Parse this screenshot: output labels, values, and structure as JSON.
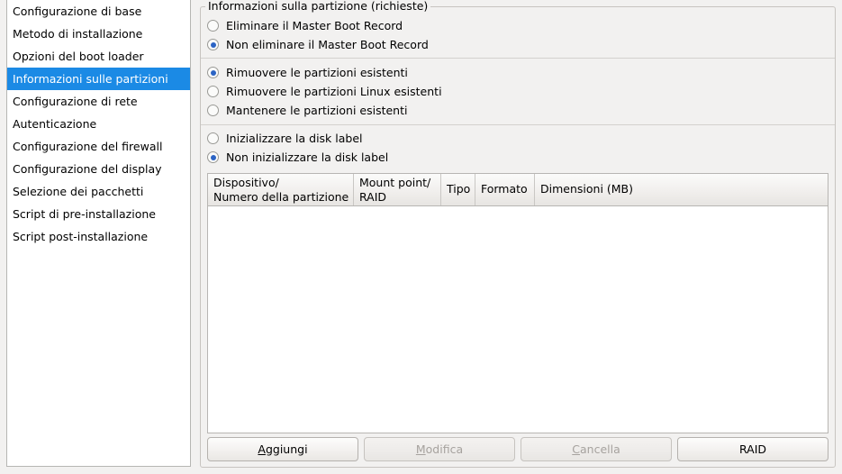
{
  "sidebar": {
    "items": [
      {
        "label": "Configurazione di base",
        "selected": false
      },
      {
        "label": "Metodo di installazione",
        "selected": false
      },
      {
        "label": "Opzioni del boot loader",
        "selected": false
      },
      {
        "label": "Informazioni sulle partizioni",
        "selected": true
      },
      {
        "label": "Configurazione di rete",
        "selected": false
      },
      {
        "label": "Autenticazione",
        "selected": false
      },
      {
        "label": "Configurazione del firewall",
        "selected": false
      },
      {
        "label": "Configurazione del display",
        "selected": false
      },
      {
        "label": "Selezione dei pacchetti",
        "selected": false
      },
      {
        "label": "Script di pre-installazione",
        "selected": false
      },
      {
        "label": "Script post-installazione",
        "selected": false
      }
    ]
  },
  "groupbox": {
    "title": "Informazioni sulla partizione (richieste)"
  },
  "radio_groups": [
    {
      "name": "mbr",
      "options": [
        {
          "label": "Eliminare il Master Boot Record",
          "checked": false
        },
        {
          "label": "Non eliminare il Master Boot Record",
          "checked": true
        }
      ]
    },
    {
      "name": "partitions",
      "options": [
        {
          "label": "Rimuovere le partizioni esistenti",
          "checked": true
        },
        {
          "label": "Rimuovere le partizioni Linux esistenti",
          "checked": false
        },
        {
          "label": "Mantenere le partizioni esistenti",
          "checked": false
        }
      ]
    },
    {
      "name": "disklabel",
      "options": [
        {
          "label": "Inizializzare la disk label",
          "checked": false
        },
        {
          "label": "Non inizializzare la disk label",
          "checked": true
        }
      ]
    }
  ],
  "table": {
    "columns": [
      "Dispositivo/\nNumero della partizione",
      "Mount point/\nRAID",
      "Tipo",
      "Formato",
      "Dimensioni (MB)"
    ],
    "rows": []
  },
  "buttons": [
    {
      "label": "Aggiungi",
      "mnemonic": "A",
      "enabled": true
    },
    {
      "label": "Modifica",
      "mnemonic": "M",
      "enabled": false
    },
    {
      "label": "Cancella",
      "mnemonic": "C",
      "enabled": false
    },
    {
      "label": "RAID",
      "mnemonic": "",
      "enabled": true
    }
  ],
  "colors": {
    "selection": "#1b8ae5",
    "radio_dot": "#2b63c4",
    "window_bg": "#f2f1f0",
    "list_bg": "#ffffff"
  }
}
